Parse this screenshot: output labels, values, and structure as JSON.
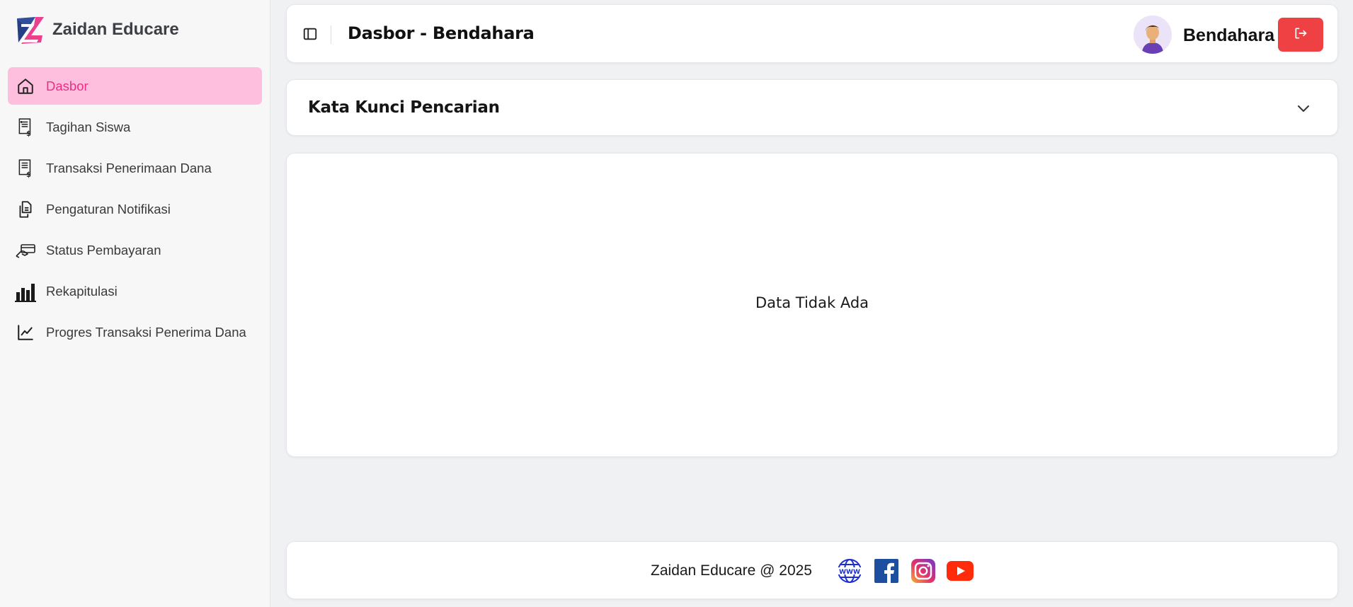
{
  "brand": {
    "name": "Zaidan Educare",
    "logo_icon": "zaidan-logo"
  },
  "colors": {
    "accent_pink": "#ea2f86",
    "active_bg": "#fdbfdd",
    "logout_red": "#ef4043"
  },
  "sidebar": {
    "items": [
      {
        "label": "Dasbor",
        "icon": "home-icon",
        "active": true
      },
      {
        "label": "Tagihan Siswa",
        "icon": "invoice-icon"
      },
      {
        "label": "Transaksi Penerimaan Dana",
        "icon": "invoice-icon"
      },
      {
        "label": "Pengaturan Notifikasi",
        "icon": "copy-icon"
      },
      {
        "label": "Status Pembayaran",
        "icon": "payment-hand-icon"
      },
      {
        "label": "Rekapitulasi",
        "icon": "bar-chart-icon"
      },
      {
        "label": "Progres Transaksi Penerima Dana",
        "icon": "line-chart-icon"
      }
    ]
  },
  "header": {
    "title": "Dasbor - Bendahara",
    "user_name": "Bendahara"
  },
  "search": {
    "title": "Kata Kunci Pencarian"
  },
  "content": {
    "empty_message": "Data Tidak Ada"
  },
  "footer": {
    "copyright": "Zaidan Educare @ 2025",
    "social": [
      "www-globe-icon",
      "facebook-icon",
      "instagram-icon",
      "youtube-icon"
    ]
  }
}
